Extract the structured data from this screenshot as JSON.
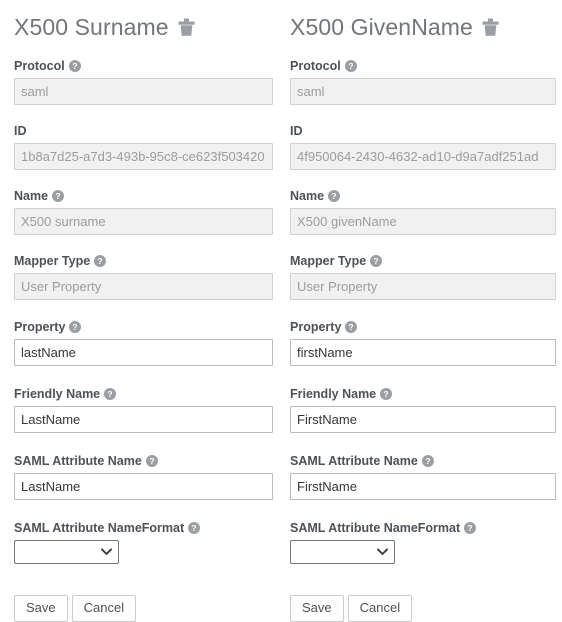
{
  "page": {
    "background": "#ffffff",
    "text_color": "#363636",
    "label_color": "#4d5258",
    "title_color": "#72767b",
    "disabled_bg": "#f1f1f1",
    "disabled_text": "#9c9c9c",
    "border_color": "#bbbbbb",
    "help_icon_color": "#9b9b9b"
  },
  "icons": {
    "trash": "trash-icon",
    "help": "help-circle-icon",
    "chevron_down": "chevron-down-icon"
  },
  "forms": [
    {
      "id": "x500-surname",
      "title": "X500 Surname",
      "delete_label": "Delete",
      "fields": {
        "protocol": {
          "label": "Protocol",
          "value": "saml",
          "disabled": true,
          "has_help": true
        },
        "id": {
          "label": "ID",
          "value": "1b8a7d25-a7d3-493b-95c8-ce623f503420",
          "disabled": true,
          "has_help": false
        },
        "name": {
          "label": "Name",
          "value": "X500 surname",
          "disabled": true,
          "has_help": true
        },
        "mapper_type": {
          "label": "Mapper Type",
          "value": "User Property",
          "disabled": true,
          "has_help": true
        },
        "property": {
          "label": "Property",
          "value": "lastName",
          "disabled": false,
          "has_help": true
        },
        "friendly_name": {
          "label": "Friendly Name",
          "value": "LastName",
          "disabled": false,
          "has_help": true
        },
        "saml_attribute_name": {
          "label": "SAML Attribute Name",
          "value": "LastName",
          "disabled": false,
          "has_help": true
        },
        "saml_attribute_nameformat": {
          "label": "SAML Attribute NameFormat",
          "value": "",
          "has_help": true,
          "options": [
            ""
          ]
        }
      },
      "buttons": {
        "save": "Save",
        "cancel": "Cancel"
      }
    },
    {
      "id": "x500-givenname",
      "title": "X500 GivenName",
      "delete_label": "Delete",
      "fields": {
        "protocol": {
          "label": "Protocol",
          "value": "saml",
          "disabled": true,
          "has_help": true
        },
        "id": {
          "label": "ID",
          "value": "4f950064-2430-4632-ad10-d9a7adf251ad",
          "disabled": true,
          "has_help": false
        },
        "name": {
          "label": "Name",
          "value": "X500 givenName",
          "disabled": true,
          "has_help": true
        },
        "mapper_type": {
          "label": "Mapper Type",
          "value": "User Property",
          "disabled": true,
          "has_help": true
        },
        "property": {
          "label": "Property",
          "value": "firstName",
          "disabled": false,
          "has_help": true
        },
        "friendly_name": {
          "label": "Friendly Name",
          "value": "FirstName",
          "disabled": false,
          "has_help": true
        },
        "saml_attribute_name": {
          "label": "SAML Attribute Name",
          "value": "FirstName",
          "disabled": false,
          "has_help": true
        },
        "saml_attribute_nameformat": {
          "label": "SAML Attribute NameFormat",
          "value": "",
          "has_help": true,
          "options": [
            ""
          ]
        }
      },
      "buttons": {
        "save": "Save",
        "cancel": "Cancel"
      }
    }
  ]
}
